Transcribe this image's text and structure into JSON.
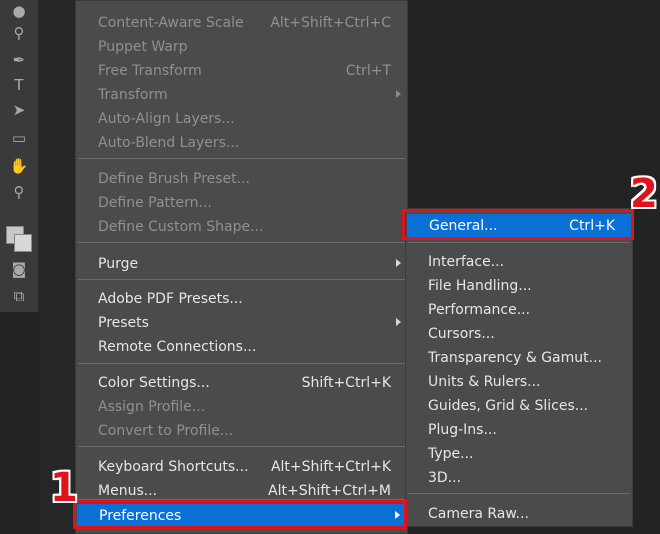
{
  "tools": [
    {
      "icon": "blur-tool-icon",
      "glyph": "●"
    },
    {
      "icon": "dodge-tool-icon",
      "glyph": "⚲"
    },
    {
      "icon": "pen-tool-icon",
      "glyph": "✒"
    },
    {
      "icon": "type-tool-icon",
      "glyph": "T"
    },
    {
      "icon": "path-selection-icon",
      "glyph": "➤"
    },
    {
      "icon": "shape-tool-icon",
      "glyph": "▭"
    },
    {
      "icon": "hand-tool-icon",
      "glyph": "✋"
    },
    {
      "icon": "zoom-tool-icon",
      "glyph": "⚲"
    },
    {
      "icon": "quick-mask-icon",
      "glyph": "◙"
    },
    {
      "icon": "screen-mode-icon",
      "glyph": "⧉"
    }
  ],
  "edit_menu": [
    {
      "label": "Content-Aware Scale",
      "shortcut": "Alt+Shift+Ctrl+C",
      "disabled": true
    },
    {
      "label": "Puppet Warp",
      "shortcut": "",
      "disabled": true
    },
    {
      "label": "Free Transform",
      "shortcut": "Ctrl+T",
      "disabled": true
    },
    {
      "label": "Transform",
      "shortcut": "",
      "disabled": true,
      "submenu": true
    },
    {
      "label": "Auto-Align Layers...",
      "shortcut": "",
      "disabled": true
    },
    {
      "label": "Auto-Blend Layers...",
      "shortcut": "",
      "disabled": true
    },
    {
      "label": "Define Brush Preset...",
      "shortcut": "",
      "disabled": true
    },
    {
      "label": "Define Pattern...",
      "shortcut": "",
      "disabled": true
    },
    {
      "label": "Define Custom Shape...",
      "shortcut": "",
      "disabled": true
    },
    {
      "label": "Purge",
      "shortcut": "",
      "disabled": false,
      "submenu": true
    },
    {
      "label": "Adobe PDF Presets...",
      "shortcut": "",
      "disabled": false
    },
    {
      "label": "Presets",
      "shortcut": "",
      "disabled": false,
      "submenu": true
    },
    {
      "label": "Remote Connections...",
      "shortcut": "",
      "disabled": false
    },
    {
      "label": "Color Settings...",
      "shortcut": "Shift+Ctrl+K",
      "disabled": false
    },
    {
      "label": "Assign Profile...",
      "shortcut": "",
      "disabled": true
    },
    {
      "label": "Convert to Profile...",
      "shortcut": "",
      "disabled": true
    },
    {
      "label": "Keyboard Shortcuts...",
      "shortcut": "Alt+Shift+Ctrl+K",
      "disabled": false
    },
    {
      "label": "Menus...",
      "shortcut": "Alt+Shift+Ctrl+M",
      "disabled": false
    },
    {
      "label": "Preferences",
      "shortcut": "",
      "disabled": false,
      "submenu": true,
      "active": true
    }
  ],
  "preferences_submenu": [
    {
      "label": "General...",
      "shortcut": "Ctrl+K",
      "active": true
    },
    {
      "label": "Interface...",
      "shortcut": ""
    },
    {
      "label": "File Handling...",
      "shortcut": ""
    },
    {
      "label": "Performance...",
      "shortcut": ""
    },
    {
      "label": "Cursors...",
      "shortcut": ""
    },
    {
      "label": "Transparency & Gamut...",
      "shortcut": ""
    },
    {
      "label": "Units & Rulers...",
      "shortcut": ""
    },
    {
      "label": "Guides, Grid & Slices...",
      "shortcut": ""
    },
    {
      "label": "Plug-Ins...",
      "shortcut": ""
    },
    {
      "label": "Type...",
      "shortcut": ""
    },
    {
      "label": "3D...",
      "shortcut": ""
    },
    {
      "label": "Camera Raw...",
      "shortcut": ""
    }
  ],
  "annotations": {
    "step1": "1",
    "step2": "2"
  },
  "colors": {
    "highlight": "#0a70d6",
    "annotation": "#e0121c",
    "menu_bg": "#4b4b4b"
  }
}
